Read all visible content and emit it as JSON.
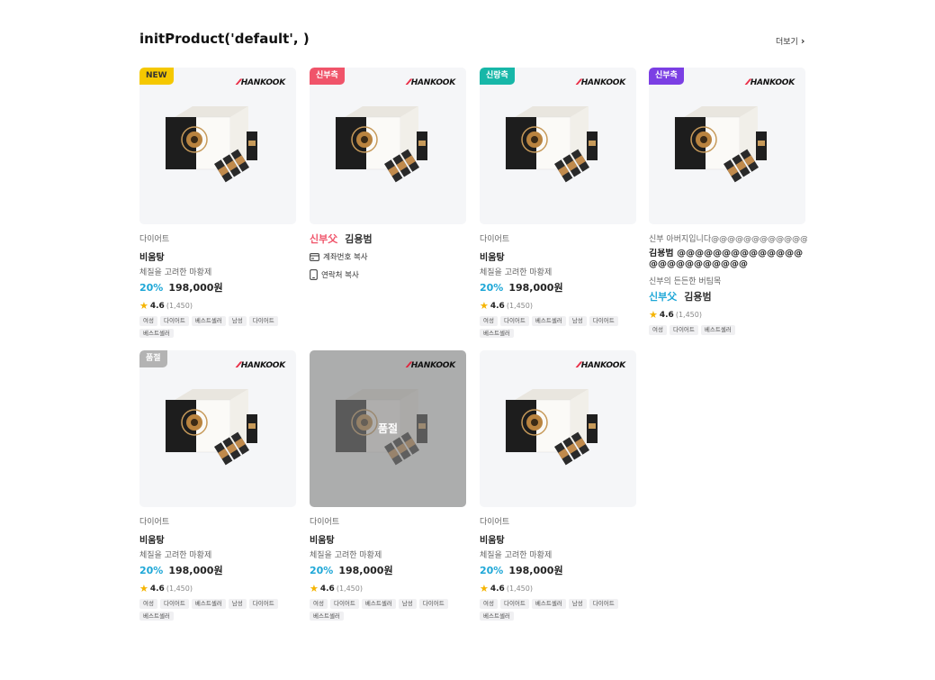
{
  "header": {
    "title": "initProduct('default', )",
    "more_label": "더보기"
  },
  "brand_name": "HANKOOK",
  "colors": {
    "discount": "#1ea7d7",
    "star": "#f5b400",
    "badge_new": "#f5c800",
    "badge_red": "#f0546a",
    "badge_teal": "#17b7a8",
    "badge_purple": "#7b3fe4",
    "badge_gray": "#b3b3b3"
  },
  "cards": [
    {
      "badge": "NEW",
      "category": "다이어트",
      "name": "비움탕",
      "desc": "체질을 고려한 마황제",
      "discount": "20%",
      "price": "198,000원",
      "rating": "4.6",
      "reviews": "(1,450)",
      "tags": [
        "여성",
        "다이어트",
        "베스트셀러",
        "남성",
        "다이어트",
        "베스트셀러"
      ]
    },
    {
      "badge": "신부측",
      "seller_a": "신부父",
      "seller_b": "김용범",
      "action_account": "계좌번호 복사",
      "action_phone": "연락처 복사"
    },
    {
      "badge": "신랑측",
      "category": "다이어트",
      "name": "비움탕",
      "desc": "체질을 고려한 마황제",
      "discount": "20%",
      "price": "198,000원",
      "rating": "4.6",
      "reviews": "(1,450)",
      "tags": [
        "여성",
        "다이어트",
        "베스트셀러",
        "남성",
        "다이어트",
        "베스트셀러"
      ]
    },
    {
      "badge": "신부측",
      "category": "신부 아버지입니다@@@@@@@@@@@@@@",
      "name": "김용범 @@@@@@@@@@@@@@@@@@@@@@@@@",
      "desc": "신부의 든든한 버팀목",
      "seller_a": "신부父",
      "seller_b": "김용범",
      "rating": "4.6",
      "reviews": "(1,450)",
      "tags": [
        "여성",
        "다이어트",
        "베스트셀러"
      ]
    },
    {
      "badge": "품절",
      "category": "다이어트",
      "name": "비움탕",
      "desc": "체질을 고려한 마황제",
      "discount": "20%",
      "price": "198,000원",
      "rating": "4.6",
      "reviews": "(1,450)",
      "tags": [
        "여성",
        "다이어트",
        "베스트셀러",
        "남성",
        "다이어트",
        "베스트셀러"
      ]
    },
    {
      "sold_out_label": "품절",
      "category": "다이어트",
      "name": "비움탕",
      "desc": "체질을 고려한 마황제",
      "discount": "20%",
      "price": "198,000원",
      "rating": "4.6",
      "reviews": "(1,450)",
      "tags": [
        "여성",
        "다이어트",
        "베스트셀러",
        "남성",
        "다이어트",
        "베스트셀러"
      ]
    },
    {
      "category": "다이어트",
      "name": "비움탕",
      "desc": "체질을 고려한 마황제",
      "discount": "20%",
      "price": "198,000원",
      "rating": "4.6",
      "reviews": "(1,450)",
      "tags": [
        "여성",
        "다이어트",
        "베스트셀러",
        "남성",
        "다이어트",
        "베스트셀러"
      ]
    }
  ]
}
